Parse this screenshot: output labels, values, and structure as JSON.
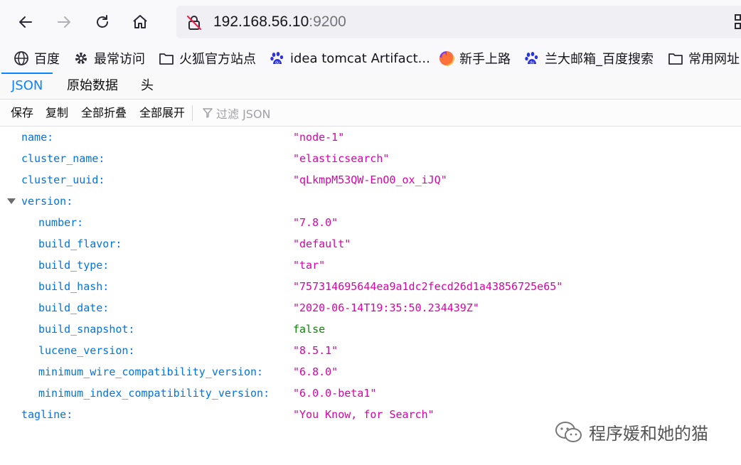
{
  "nav": {
    "url_host": "192.168.56.10",
    "url_port": ":9200",
    "icons": [
      "back-icon",
      "forward-icon",
      "reload-icon",
      "home-icon",
      "insecure-lock-icon",
      "qr-code-icon"
    ]
  },
  "bookmarks": [
    {
      "label": "百度",
      "icon": "globe-icon"
    },
    {
      "label": "最常访问",
      "icon": "gear-icon"
    },
    {
      "label": "火狐官方站点",
      "icon": "folder-icon"
    },
    {
      "label": "idea tomcat Artifact...",
      "icon": "baidu-paw-icon"
    },
    {
      "label": "新手上路",
      "icon": "firefox-icon"
    },
    {
      "label": "兰大邮箱_百度搜索",
      "icon": "baidu-paw-icon"
    },
    {
      "label": "常用网址",
      "icon": "folder-icon"
    }
  ],
  "tabs": [
    {
      "label": "JSON",
      "selected": true
    },
    {
      "label": "原始数据",
      "selected": false
    },
    {
      "label": "头",
      "selected": false
    }
  ],
  "toolbar": {
    "save": "保存",
    "copy": "复制",
    "collapse_all": "全部折叠",
    "expand_all": "全部展开",
    "filter_placeholder": "过滤 JSON"
  },
  "json": {
    "name": {
      "key": "name:",
      "value": "\"node-1\""
    },
    "cluster_name": {
      "key": "cluster_name:",
      "value": "\"elasticsearch\""
    },
    "cluster_uuid": {
      "key": "cluster_uuid:",
      "value": "\"qLkmpM53QW-EnO0_ox_iJQ\""
    },
    "version": {
      "key": "version:",
      "number": {
        "key": "number:",
        "value": "\"7.8.0\""
      },
      "build_flavor": {
        "key": "build_flavor:",
        "value": "\"default\""
      },
      "build_type": {
        "key": "build_type:",
        "value": "\"tar\""
      },
      "build_hash": {
        "key": "build_hash:",
        "value": "\"757314695644ea9a1dc2fecd26d1a43856725e65\""
      },
      "build_date": {
        "key": "build_date:",
        "value": "\"2020-06-14T19:35:50.234439Z\""
      },
      "build_snapshot": {
        "key": "build_snapshot:",
        "value": "false"
      },
      "lucene_version": {
        "key": "lucene_version:",
        "value": "\"8.5.1\""
      },
      "minimum_wire_compatibility_version": {
        "key": "minimum_wire_compatibility_version:",
        "value": "\"6.8.0\""
      },
      "minimum_index_compatibility_version": {
        "key": "minimum_index_compatibility_version:",
        "value": "\"6.0.0-beta1\""
      }
    },
    "tagline": {
      "key": "tagline:",
      "value": "\"You Know, for Search\""
    }
  },
  "colors": {
    "key": "#0074e8",
    "string": "#dd00a9",
    "boolean": "#058b00",
    "tab_selected": "#0a84ff"
  },
  "watermark": {
    "text": "程序媛和她的猫",
    "icon": "wechat-icon"
  }
}
